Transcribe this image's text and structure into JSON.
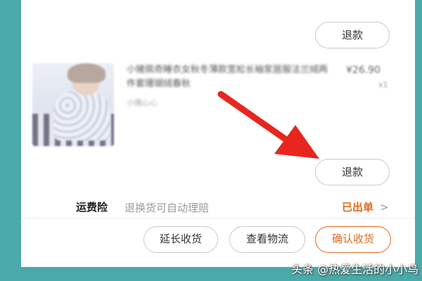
{
  "order": {
    "refund_top_label": "退款",
    "refund_item_label": "退款",
    "product": {
      "title": "小猪佩奇睡衣女秋冬薄款宽松长袖家居服法兰绒两件套珊瑚绒春秋",
      "shop": "小猪心心",
      "price": "¥26.90",
      "quantity": "x1"
    }
  },
  "insurance": {
    "label": "运费险",
    "description": "退换货可自动理赔",
    "status": "已出单"
  },
  "actions": {
    "extend_label": "延长收货",
    "logistics_label": "查看物流",
    "confirm_label": "确认收货"
  },
  "watermark": "头条 @热爱生活的小小鸟",
  "colors": {
    "background": "#4aa9a9",
    "accent": "#e26a1c",
    "arrow": "#e8251f"
  },
  "icons": [
    "red-arrow-icon",
    "chevron-right-icon"
  ]
}
